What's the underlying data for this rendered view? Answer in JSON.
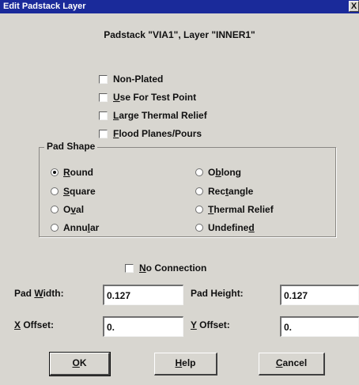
{
  "window": {
    "title": "Edit Padstack Layer",
    "close_label": "X"
  },
  "header": {
    "text": "Padstack \"VIA1\", Layer \"INNER1\""
  },
  "checkboxes": {
    "non_plated": {
      "label": "Non-Plated",
      "checked": false
    },
    "test_point": {
      "pre": "",
      "mn": "U",
      "post": "se For Test Point",
      "checked": false
    },
    "large_thermal": {
      "pre": "",
      "mn": "L",
      "post": "arge Thermal Relief",
      "checked": false
    },
    "flood": {
      "pre": "",
      "mn": "F",
      "post": "lood Planes/Pours",
      "checked": false
    },
    "no_connection": {
      "pre": "",
      "mn": "N",
      "post": "o Connection",
      "checked": false
    }
  },
  "pad_shape": {
    "legend": "Pad Shape",
    "selected": "Round",
    "round": {
      "pre": "",
      "mn": "R",
      "post": "ound"
    },
    "square": {
      "pre": "",
      "mn": "S",
      "post": "quare"
    },
    "oval": {
      "pre": "O",
      "mn": "v",
      "post": "al"
    },
    "annular": {
      "pre": "Annu",
      "mn": "l",
      "post": "ar"
    },
    "oblong": {
      "pre": "O",
      "mn": "b",
      "post": "long"
    },
    "rectangle": {
      "pre": "Rec",
      "mn": "t",
      "post": "angle"
    },
    "thermal": {
      "pre": "",
      "mn": "T",
      "post": "hermal Relief"
    },
    "undefined": {
      "pre": "Undefine",
      "mn": "d",
      "post": ""
    }
  },
  "fields": {
    "pad_width": {
      "pre": "Pad ",
      "mn": "W",
      "post": "idth:",
      "value": "0.127"
    },
    "pad_height": {
      "pre": "Pad Hei",
      "mn": "g",
      "post": "ht:",
      "value": "0.127"
    },
    "x_offset": {
      "pre": "",
      "mn": "X",
      "post": " Offset:",
      "value": "0."
    },
    "y_offset": {
      "pre": "",
      "mn": "Y",
      "post": " Offset:",
      "value": "0."
    }
  },
  "buttons": {
    "ok": {
      "pre": "",
      "mn": "O",
      "post": "K"
    },
    "help": {
      "pre": "",
      "mn": "H",
      "post": "elp"
    },
    "cancel": {
      "pre": "",
      "mn": "C",
      "post": "ancel"
    }
  }
}
